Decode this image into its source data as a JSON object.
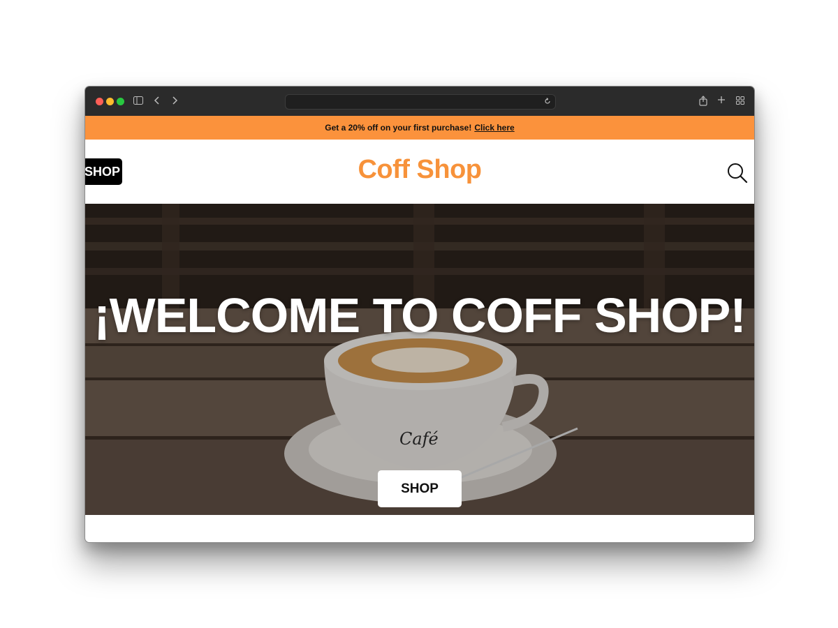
{
  "browser": {
    "address": "",
    "colors": {
      "close": "#ff5f57",
      "minimize": "#febc2e",
      "maximize": "#28c840",
      "chrome": "#2b2b2b"
    }
  },
  "promo": {
    "text": "Get a 20% off on your first purchase!",
    "link": "Click here",
    "background": "#fb923c"
  },
  "header": {
    "shop_label": "SHOP",
    "brand": "Coff Shop",
    "brand_color": "#f7923a",
    "search_icon": "search-icon"
  },
  "hero": {
    "title": "¡WELCOME TO COFF SHOP!",
    "cup_text": "Café",
    "button_label": "SHOP"
  }
}
